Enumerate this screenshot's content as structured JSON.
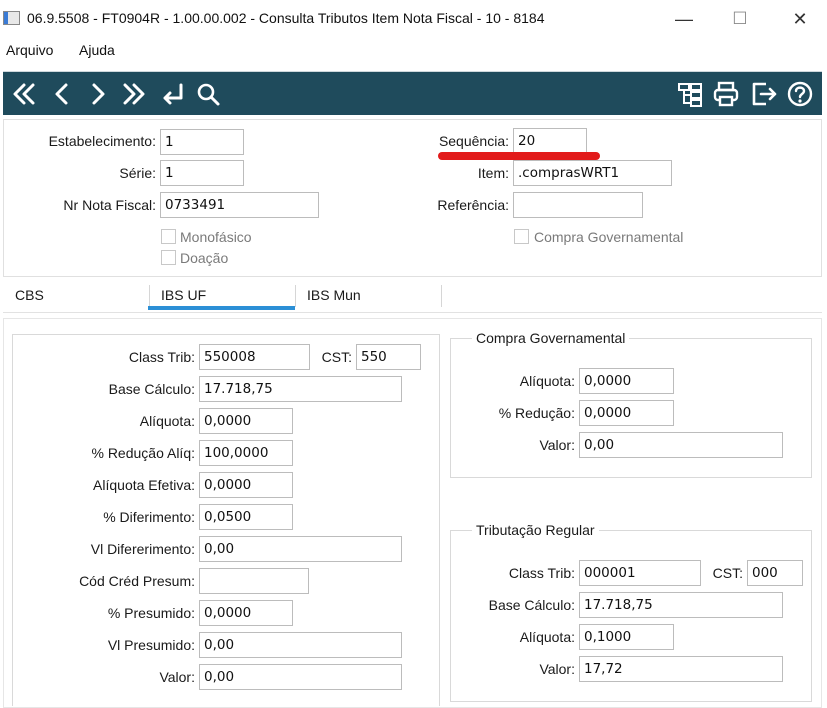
{
  "window": {
    "title": "06.9.5508 - FT0904R - 1.00.00.002 - Consulta Tributos Item Nota Fiscal - 10 - 8184",
    "minimize": "—",
    "maximize": "☐",
    "close": "✕"
  },
  "menu": {
    "arquivo": "Arquivo",
    "ajuda": "Ajuda"
  },
  "toolbar": {
    "icons": [
      "first-icon",
      "previous-icon",
      "next-icon",
      "last-icon",
      "goto-icon",
      "search-icon",
      "navigator-icon",
      "print-icon",
      "exit-icon",
      "help-icon"
    ],
    "color": "#1f4b5c"
  },
  "header": {
    "estabelecimento": {
      "label": "Estabelecimento:",
      "value": "1"
    },
    "serie": {
      "label": "Série:",
      "value": "1"
    },
    "nr_nota": {
      "label": "Nr Nota Fiscal:",
      "value": "0733491"
    },
    "monofasico": {
      "label": "Monofásico",
      "checked": false
    },
    "doacao": {
      "label": "Doação",
      "checked": false
    },
    "sequencia": {
      "label": "Sequência:",
      "value": "20"
    },
    "item": {
      "label": "Item:",
      "value": ".comprasWRT1"
    },
    "referencia": {
      "label": "Referência:",
      "value": ""
    },
    "compra_gov": {
      "label": "Compra Governamental",
      "checked": false
    }
  },
  "tabs": [
    {
      "label": "CBS",
      "active": false
    },
    {
      "label": "IBS UF",
      "active": true
    },
    {
      "label": "IBS Mun",
      "active": false
    }
  ],
  "left": {
    "class_trib": {
      "label": "Class Trib:",
      "value": "550008"
    },
    "cst": {
      "label": "CST:",
      "value": "550"
    },
    "base_calculo": {
      "label": "Base Cálculo:",
      "value": "17.718,75"
    },
    "aliquota": {
      "label": "Alíquota:",
      "value": "0,0000"
    },
    "reducao_aliq": {
      "label": "% Redução Alíq:",
      "value": "100,0000"
    },
    "aliquota_efetiva": {
      "label": "Alíquota Efetiva:",
      "value": "0,0000"
    },
    "diferimento": {
      "label": "% Diferimento:",
      "value": "0,0500"
    },
    "vl_diferimento": {
      "label": "Vl Difererimento:",
      "value": "0,00"
    },
    "cod_cred_presum": {
      "label": "Cód Créd Presum:",
      "value": ""
    },
    "presumido": {
      "label": "% Presumido:",
      "value": "0,0000"
    },
    "vl_presumido": {
      "label": "Vl Presumido:",
      "value": "0,00"
    },
    "valor": {
      "label": "Valor:",
      "value": "0,00"
    }
  },
  "compra_governamental": {
    "title": "Compra Governamental",
    "aliquota": {
      "label": "Alíquota:",
      "value": "0,0000"
    },
    "reducao": {
      "label": "% Redução:",
      "value": "0,0000"
    },
    "valor": {
      "label": "Valor:",
      "value": "0,00"
    }
  },
  "tributacao_regular": {
    "title": "Tributação Regular",
    "class_trib": {
      "label": "Class Trib:",
      "value": "000001"
    },
    "cst": {
      "label": "CST:",
      "value": "000"
    },
    "base_calculo": {
      "label": "Base Cálculo:",
      "value": "17.718,75"
    },
    "aliquota": {
      "label": "Alíquota:",
      "value": "0,1000"
    },
    "valor": {
      "label": "Valor:",
      "value": "17,72"
    }
  },
  "colors": {
    "highlight": "#e21b1b",
    "tab_underline": "#2b8fd6"
  }
}
